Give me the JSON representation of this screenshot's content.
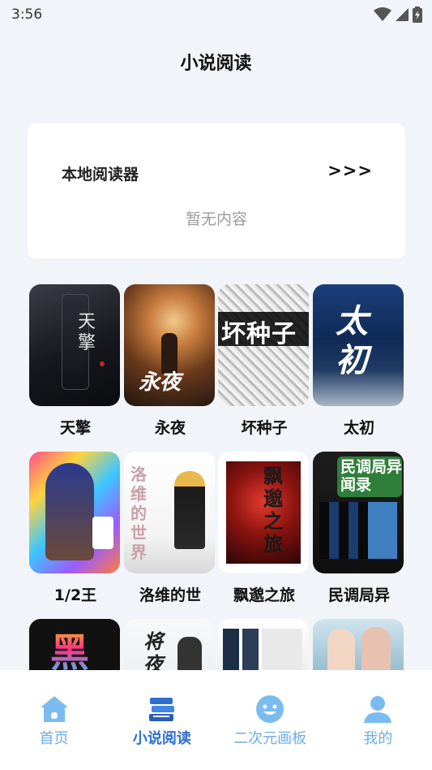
{
  "status": {
    "time": "3:56"
  },
  "header": {
    "title": "小说阅读"
  },
  "reader": {
    "title": "本地阅读器",
    "more": ">>>",
    "empty": "暂无内容"
  },
  "books": [
    {
      "title": "天擎",
      "cover_text": "天擎"
    },
    {
      "title": "永夜",
      "cover_text": "永夜"
    },
    {
      "title": "坏种子",
      "cover_text": "坏种子"
    },
    {
      "title": "太初",
      "cover_text": "太初"
    },
    {
      "title": "1/2王",
      "cover_text": ""
    },
    {
      "title": "洛维的世",
      "cover_text": "洛维的世界"
    },
    {
      "title": "飘邈之旅",
      "cover_text": "飘邈之旅"
    },
    {
      "title": "民调局异",
      "cover_text": "民调局异闻录"
    },
    {
      "title": "",
      "cover_text": "黑"
    },
    {
      "title": "",
      "cover_text": "将夜"
    },
    {
      "title": "",
      "cover_text": ""
    },
    {
      "title": "",
      "cover_text": ""
    }
  ],
  "tabs": [
    {
      "label": "首页",
      "icon": "home-icon",
      "active": false
    },
    {
      "label": "小说阅读",
      "icon": "books-icon",
      "active": true
    },
    {
      "label": "二次元画板",
      "icon": "smiley-icon",
      "active": false
    },
    {
      "label": "我的",
      "icon": "user-icon",
      "active": false
    }
  ],
  "colors": {
    "accent": "#2f6fd0",
    "tab_inactive": "#6aaee6",
    "background": "#f1f4f8"
  }
}
